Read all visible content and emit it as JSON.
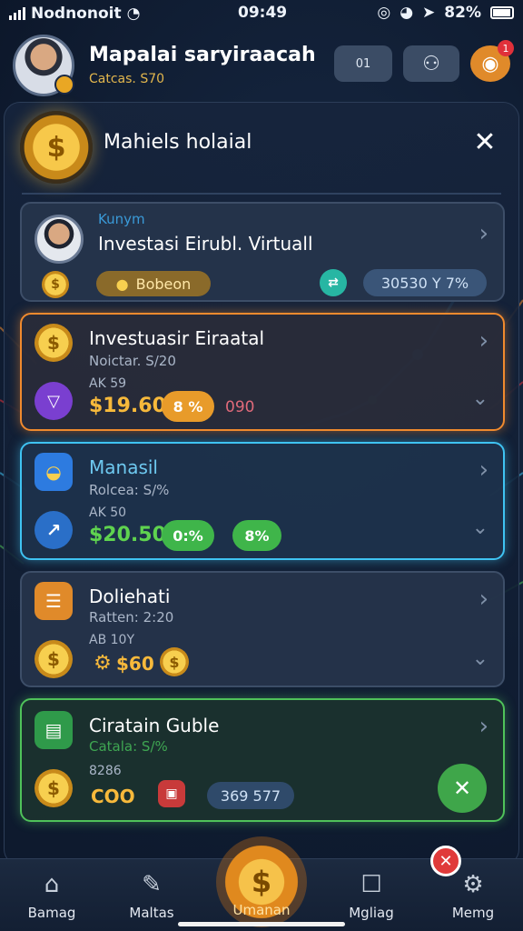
{
  "status_bar": {
    "carrier": "Nodnonoit",
    "time": "09:49",
    "battery": "82%"
  },
  "header": {
    "name": "Mapalai saryiraacah",
    "subtitle": "Catcas. S70",
    "button_1_label": "01",
    "badge_count": "1"
  },
  "panel": {
    "title": "Mahiels holaial"
  },
  "cards": [
    {
      "label_small": "Kunym",
      "title": "Investasi Eirubl. Virtuall",
      "pill_label": "Bobeon",
      "value_text": "30530  Y 7%"
    },
    {
      "title": "Investuasir Eiraatal",
      "subtitle": "Noictar. S/20",
      "small": "AK 59",
      "amount": "$19.60",
      "percent": "8 %",
      "extra": "090"
    },
    {
      "title": "Manasil",
      "subtitle": "Rolcea: S/%",
      "small": "AK 50",
      "amount": "$20.50",
      "percent": "0:%",
      "percent2": "8%"
    },
    {
      "title": "Doliehati",
      "subtitle": "Ratten: 2:20",
      "small": "AB 10Y",
      "amount": "$60",
      "badge_text": "$"
    },
    {
      "title": "Ciratain Guble",
      "subtitle": "Catala: S/%",
      "small": "8286",
      "coins_text": "COO",
      "value_text": "369  577"
    }
  ],
  "bottom_nav": [
    {
      "label": "Bamag",
      "icon": "home-icon"
    },
    {
      "label": "Maltas",
      "icon": "edit-icon"
    },
    {
      "label": "Umanan",
      "icon": "coin-icon"
    },
    {
      "label": "Mgliag",
      "icon": "tag-icon"
    },
    {
      "label": "Memg",
      "icon": "gear-icon"
    }
  ],
  "colors": {
    "accent_gold": "#f2b93b",
    "orange": "#f08a2e",
    "blue": "#3fc3f2",
    "green": "#4fc25a",
    "red": "#e03a3a"
  }
}
